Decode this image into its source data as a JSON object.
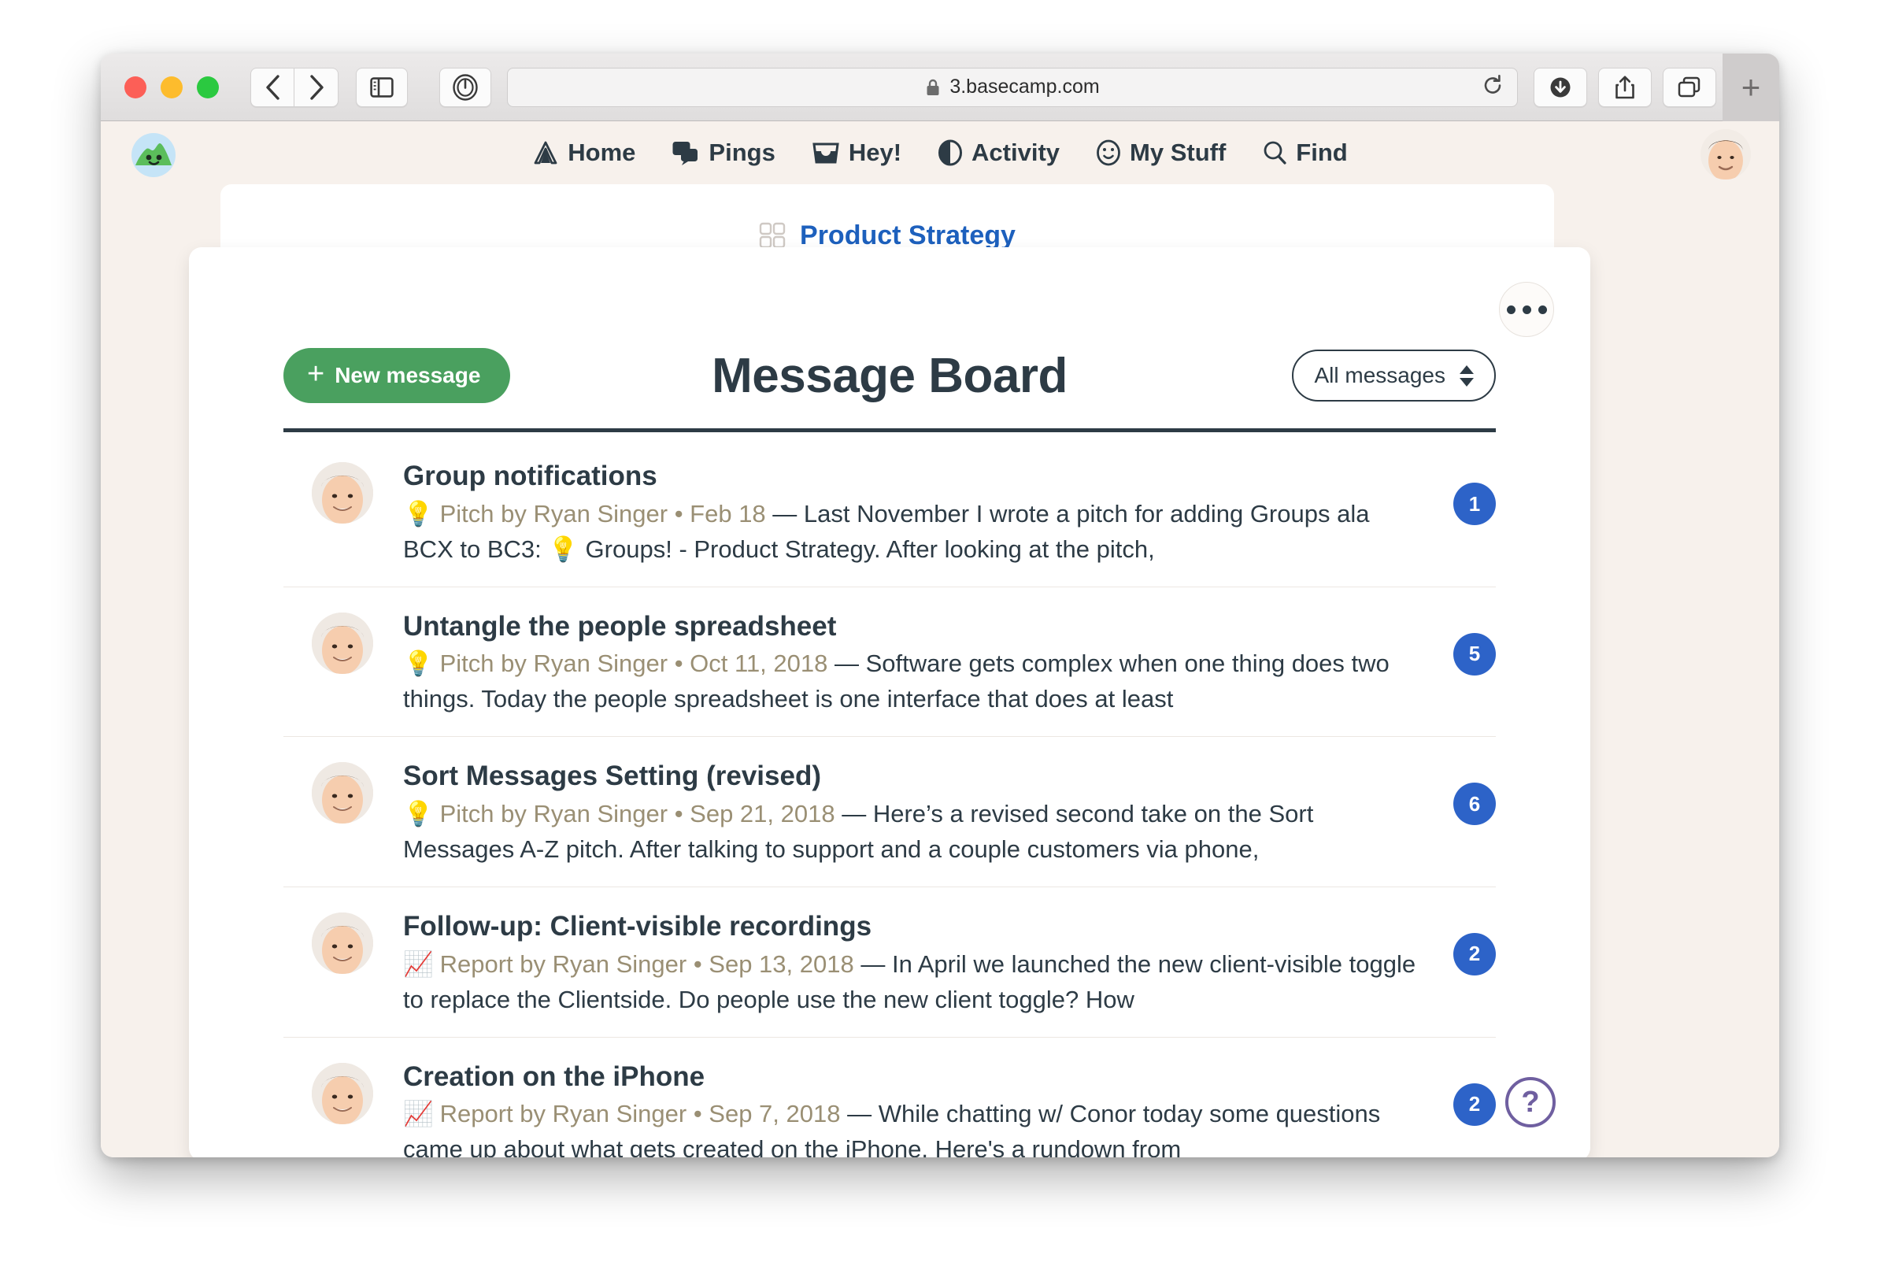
{
  "browser": {
    "url": "3.basecamp.com",
    "lock_icon": "lock-icon",
    "reload_icon": "reload-icon",
    "back_icon": "chevron-left-icon",
    "forward_icon": "chevron-right-icon",
    "sidebar_icon": "sidebar-toggle-icon",
    "password_icon": "onepassword-icon",
    "downloads_icon": "downloads-icon",
    "share_icon": "share-icon",
    "tab_overview_icon": "tab-overview-icon",
    "new_tab_label": "+",
    "traffic_lights": [
      "close",
      "minimize",
      "zoom"
    ]
  },
  "app": {
    "logo_icon": "basecamp-hill-logo",
    "avatar_icon": "user-avatar",
    "nav": [
      {
        "label": "Home",
        "icon": "tent-icon"
      },
      {
        "label": "Pings",
        "icon": "chat-bubbles-icon"
      },
      {
        "label": "Hey!",
        "icon": "inbox-tray-icon"
      },
      {
        "label": "Activity",
        "icon": "half-circle-icon"
      },
      {
        "label": "My Stuff",
        "icon": "smiley-face-icon"
      },
      {
        "label": "Find",
        "icon": "magnifier-icon"
      }
    ]
  },
  "breadcrumb": {
    "icon": "grid-squares-icon",
    "label": "Product Strategy"
  },
  "board": {
    "title": "Message Board",
    "new_message_label": "New message",
    "new_message_plus": "+",
    "filter_value": "All messages",
    "more_menu_icon": "ellipsis-icon",
    "help_label": "?",
    "accent_green": "#4aa05f",
    "accent_blue": "#2d63c8",
    "accent_purple": "#6f5fa0",
    "link_blue": "#1d60bd",
    "ink": "#2d3b45",
    "meta_color": "#9a8f74"
  },
  "messages": [
    {
      "title": "Group notifications",
      "kind_icon": "lightbulb-icon",
      "kind_glyph": "💡",
      "meta": "Pitch by Ryan Singer • Feb 18",
      "excerpt": " — Last November I wrote a pitch for adding Groups ala BCX to BC3: 💡 Groups! - Product Strategy. After looking at the pitch,",
      "badge": "1"
    },
    {
      "title": "Untangle the people spreadsheet",
      "kind_icon": "lightbulb-icon",
      "kind_glyph": "💡",
      "meta": "Pitch by Ryan Singer • Oct 11, 2018",
      "excerpt": " — Software gets complex when one thing does two things. Today the people spreadsheet is one interface that does at least",
      "badge": "5"
    },
    {
      "title": "Sort Messages Setting (revised)",
      "kind_icon": "lightbulb-icon",
      "kind_glyph": "💡",
      "meta": "Pitch by Ryan Singer • Sep 21, 2018",
      "excerpt": " — Here’s a revised second take on the Sort Messages A-Z pitch. After talking to support and a couple customers via phone,",
      "badge": "6"
    },
    {
      "title": "Follow-up: Client-visible recordings",
      "kind_icon": "chart-increasing-icon",
      "kind_glyph": "📈",
      "meta": "Report by Ryan Singer • Sep 13, 2018",
      "excerpt": " — In April we launched the new client-visible toggle to replace the Clientside. Do people use the new client toggle? How",
      "badge": "2"
    },
    {
      "title": "Creation on the iPhone",
      "kind_icon": "chart-increasing-icon",
      "kind_glyph": "📈",
      "meta": "Report by Ryan Singer • Sep 7, 2018",
      "excerpt": " — While chatting w/ Conor today some questions came up about what gets created on the iPhone. Here's a rundown from",
      "badge": "2"
    }
  ]
}
